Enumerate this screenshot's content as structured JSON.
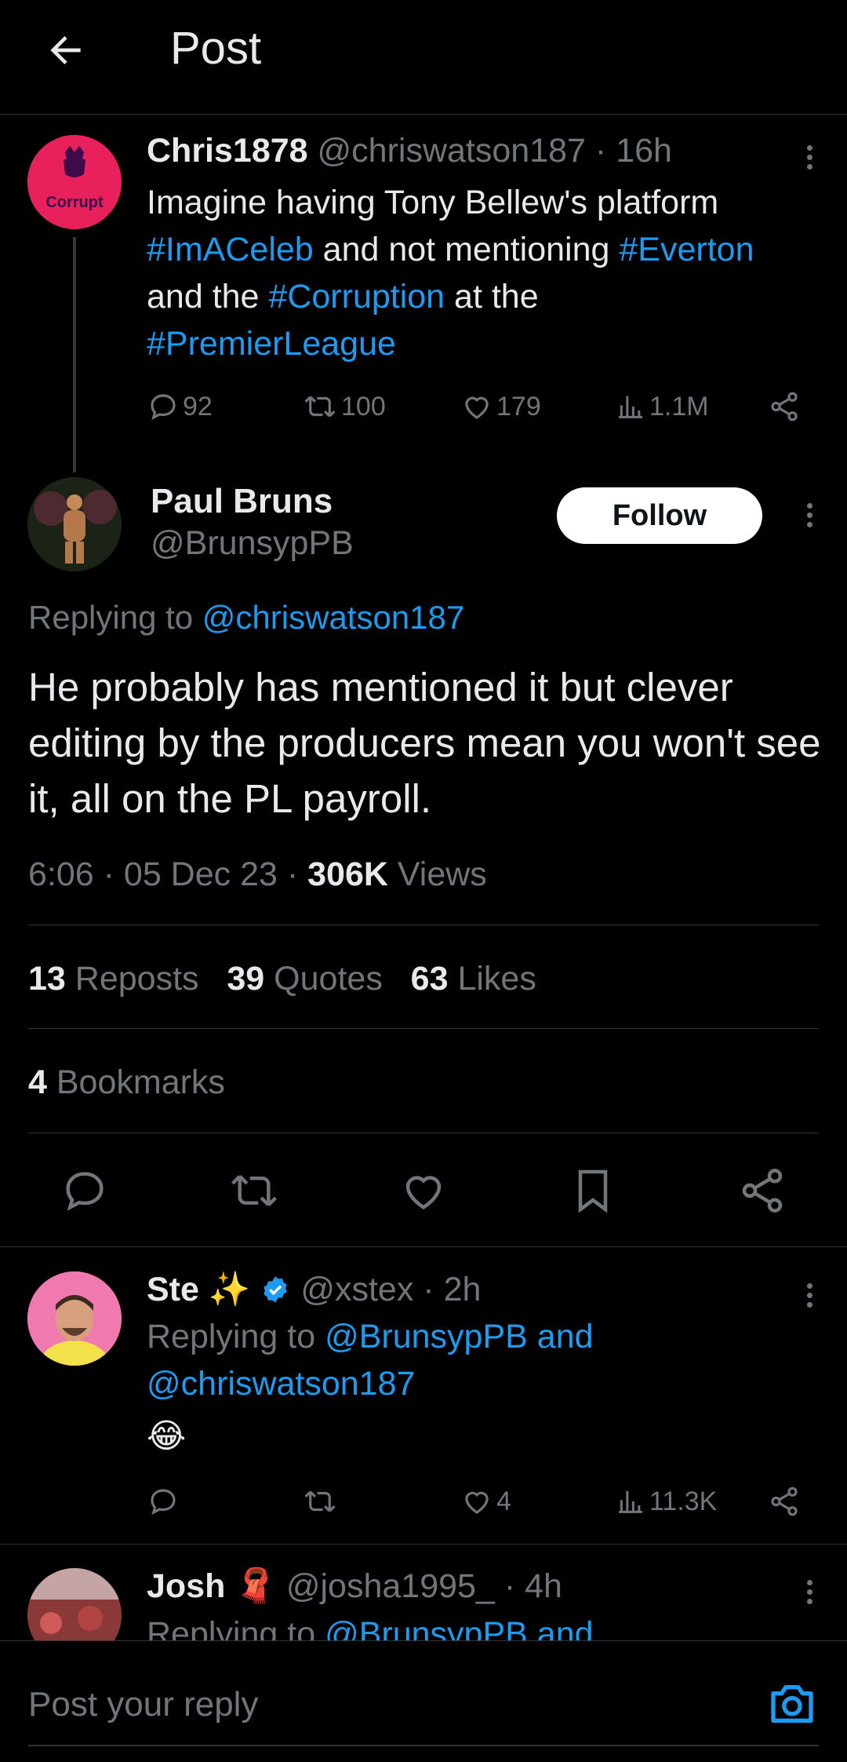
{
  "header": {
    "title": "Post"
  },
  "parent": {
    "name": "Chris1878",
    "handle": "@chriswatson187",
    "time": "· 16h",
    "avatar_text": "Corrupt",
    "text_parts": {
      "p1": "Imagine having Tony Bellew's platform",
      "h1": "#ImACeleb",
      "p2": " and not mentioning ",
      "h2": "#Everton",
      "p3": "and the ",
      "h3": "#Corruption",
      "p4": " at the",
      "h4": "#PremierLeague"
    },
    "replies": "92",
    "reposts": "100",
    "likes": "179",
    "views": "1.1M"
  },
  "main": {
    "name": "Paul Bruns",
    "handle": "@BrunsypPB",
    "follow_label": "Follow",
    "replying_label": "Replying to ",
    "replying_to": "@chriswatson187",
    "text": "He probably has mentioned it but clever editing by the producers mean you won't see it, all on the PL payroll.",
    "time": "6:06 · 05 Dec 23 · ",
    "views_count": "306K",
    "views_label": " Views",
    "reposts_count": "13",
    "reposts_label": " Reposts",
    "quotes_count": "39",
    "quotes_label": " Quotes",
    "likes_count": "63",
    "likes_label": " Likes",
    "bookmarks_count": "4",
    "bookmarks_label": " Bookmarks"
  },
  "reply1": {
    "name": "Ste",
    "emoji": "✨",
    "handle": "@xstex",
    "time": "· 2h",
    "replying_label": "Replying to ",
    "replying_to": "@BrunsypPB and",
    "replying_to2": "@chriswatson187",
    "text": "😂",
    "likes": "4",
    "views": "11.3K"
  },
  "reply2": {
    "name": "Josh",
    "emoji": "🧣",
    "handle": "@josha1995_",
    "time": "· 4h",
    "replying_label": "Replying to ",
    "replying_to": "@BrunsypPB and"
  },
  "reply_bar": {
    "placeholder": "Post your reply"
  },
  "colors": {
    "accent": "#1d9bf0",
    "muted": "#71767b",
    "background": "#000000"
  }
}
